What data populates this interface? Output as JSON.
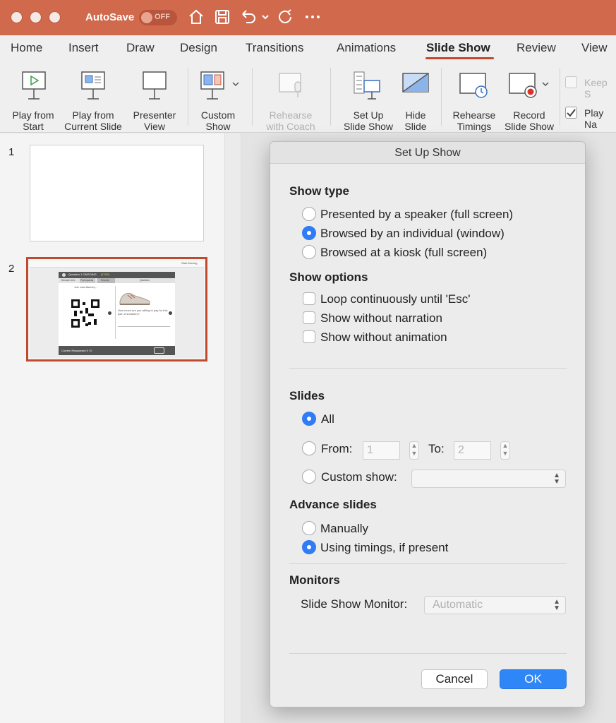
{
  "titlebar": {
    "autosave_label": "AutoSave",
    "autosave_state": "OFF",
    "accent_color": "#d1694d"
  },
  "tabs": [
    "Home",
    "Insert",
    "Draw",
    "Design",
    "Transitions",
    "Animations",
    "Slide Show",
    "Review",
    "View"
  ],
  "active_tab": "Slide Show",
  "ribbon": {
    "play_from_start": [
      "Play from",
      "Start"
    ],
    "play_from_current": [
      "Play from",
      "Current Slide"
    ],
    "presenter_view": [
      "Presenter",
      "View"
    ],
    "custom_show": [
      "Custom",
      "Show"
    ],
    "rehearse_coach": [
      "Rehearse",
      "with Coach"
    ],
    "setup_show": [
      "Set Up",
      "Slide Show"
    ],
    "hide_slide": [
      "Hide",
      "Slide"
    ],
    "rehearse_timings": [
      "Rehearse",
      "Timings"
    ],
    "record_slide_show": [
      "Record",
      "Slide Show"
    ],
    "keep_label": "Keep S",
    "play_label": "Play Na"
  },
  "thumbnails": {
    "slide1_number": "1",
    "slide2_number": "2",
    "slide2": {
      "question_header": "Question 1  ONGOING",
      "code": "[17X0]",
      "tab1": "Session Info",
      "tab2": "Participants",
      "tab3": "Results",
      "tab4": "Question",
      "join_text": "Join: www.tksurvey...",
      "question_text": "How much are you willing to pay for this pair of sneakers?",
      "footer_text": "Current Responses 0 / 0",
      "account": "Start Moving"
    }
  },
  "dialog": {
    "title": "Set Up Show",
    "show_type": {
      "heading": "Show type",
      "options": [
        "Presented by a speaker (full screen)",
        "Browsed by an individual (window)",
        "Browsed at a kiosk (full screen)"
      ],
      "selected": "Browsed by an individual (window)"
    },
    "show_options": {
      "heading": "Show options",
      "options": [
        "Loop continuously until 'Esc'",
        "Show without narration",
        "Show without animation"
      ]
    },
    "slides": {
      "heading": "Slides",
      "all_label": "All",
      "from_label": "From:",
      "from_value": "1",
      "to_label": "To:",
      "to_value": "2",
      "custom_label": "Custom show:",
      "custom_value": "",
      "selected": "All"
    },
    "advance": {
      "heading": "Advance slides",
      "options": [
        "Manually",
        "Using timings, if present"
      ],
      "selected": "Using timings, if present"
    },
    "monitors": {
      "heading": "Monitors",
      "monitor_label": "Slide Show Monitor:",
      "monitor_value": "Automatic"
    },
    "cancel_label": "Cancel",
    "ok_label": "OK"
  }
}
